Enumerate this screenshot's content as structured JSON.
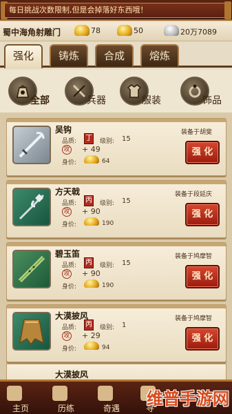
{
  "banner": {
    "text": "每日挑战次数限制,但是会掉落好东西哦！"
  },
  "resources": {
    "location": "蜀中海角射雕门",
    "gold": "78",
    "ingot": "50",
    "silver": "20万7089"
  },
  "tabs": [
    {
      "label": "强化",
      "active": true
    },
    {
      "label": "铸炼",
      "active": false
    },
    {
      "label": "合成",
      "active": false
    },
    {
      "label": "熔炼",
      "active": false
    }
  ],
  "categories": [
    {
      "label": "全部",
      "icon": "bag-icon",
      "active": true
    },
    {
      "label": "兵器",
      "icon": "weapon-icon",
      "active": false
    },
    {
      "label": "服装",
      "icon": "armor-icon",
      "active": false
    },
    {
      "label": "饰品",
      "icon": "ring-icon",
      "active": false
    }
  ],
  "labels": {
    "quality": "品质:",
    "level": "级别:",
    "value": "身价:",
    "attack_glyph": "攻",
    "strengthen": "强 化"
  },
  "items": [
    {
      "name": "吴钩",
      "quality_glyph": "丁",
      "level": "15",
      "bonus": "+ 49",
      "value": "64",
      "equipped": "装备于胡斐",
      "thumb": "gray"
    },
    {
      "name": "方天戟",
      "quality_glyph": "丙",
      "level": "15",
      "bonus": "+ 90",
      "value": "190",
      "equipped": "装备于段延庆",
      "thumb": "green"
    },
    {
      "name": "碧玉笛",
      "quality_glyph": "丙",
      "level": "15",
      "bonus": "+ 90",
      "value": "190",
      "equipped": "装备于鸠摩智",
      "thumb": "yellow"
    },
    {
      "name": "大漠披风",
      "quality_glyph": "丙",
      "level": "1",
      "bonus": "+ 29",
      "value": "94",
      "equipped": "装备于鸠摩智",
      "thumb": "green"
    }
  ],
  "partial_item": {
    "name": "大漠披风"
  },
  "nav": [
    {
      "label": "主页",
      "icon": "home-icon"
    },
    {
      "label": "历练",
      "icon": "sword-icon"
    },
    {
      "label": "奇遇",
      "icon": "mountain-icon"
    },
    {
      "label": "寻",
      "icon": "search-icon"
    }
  ],
  "watermark": "维普手游网"
}
